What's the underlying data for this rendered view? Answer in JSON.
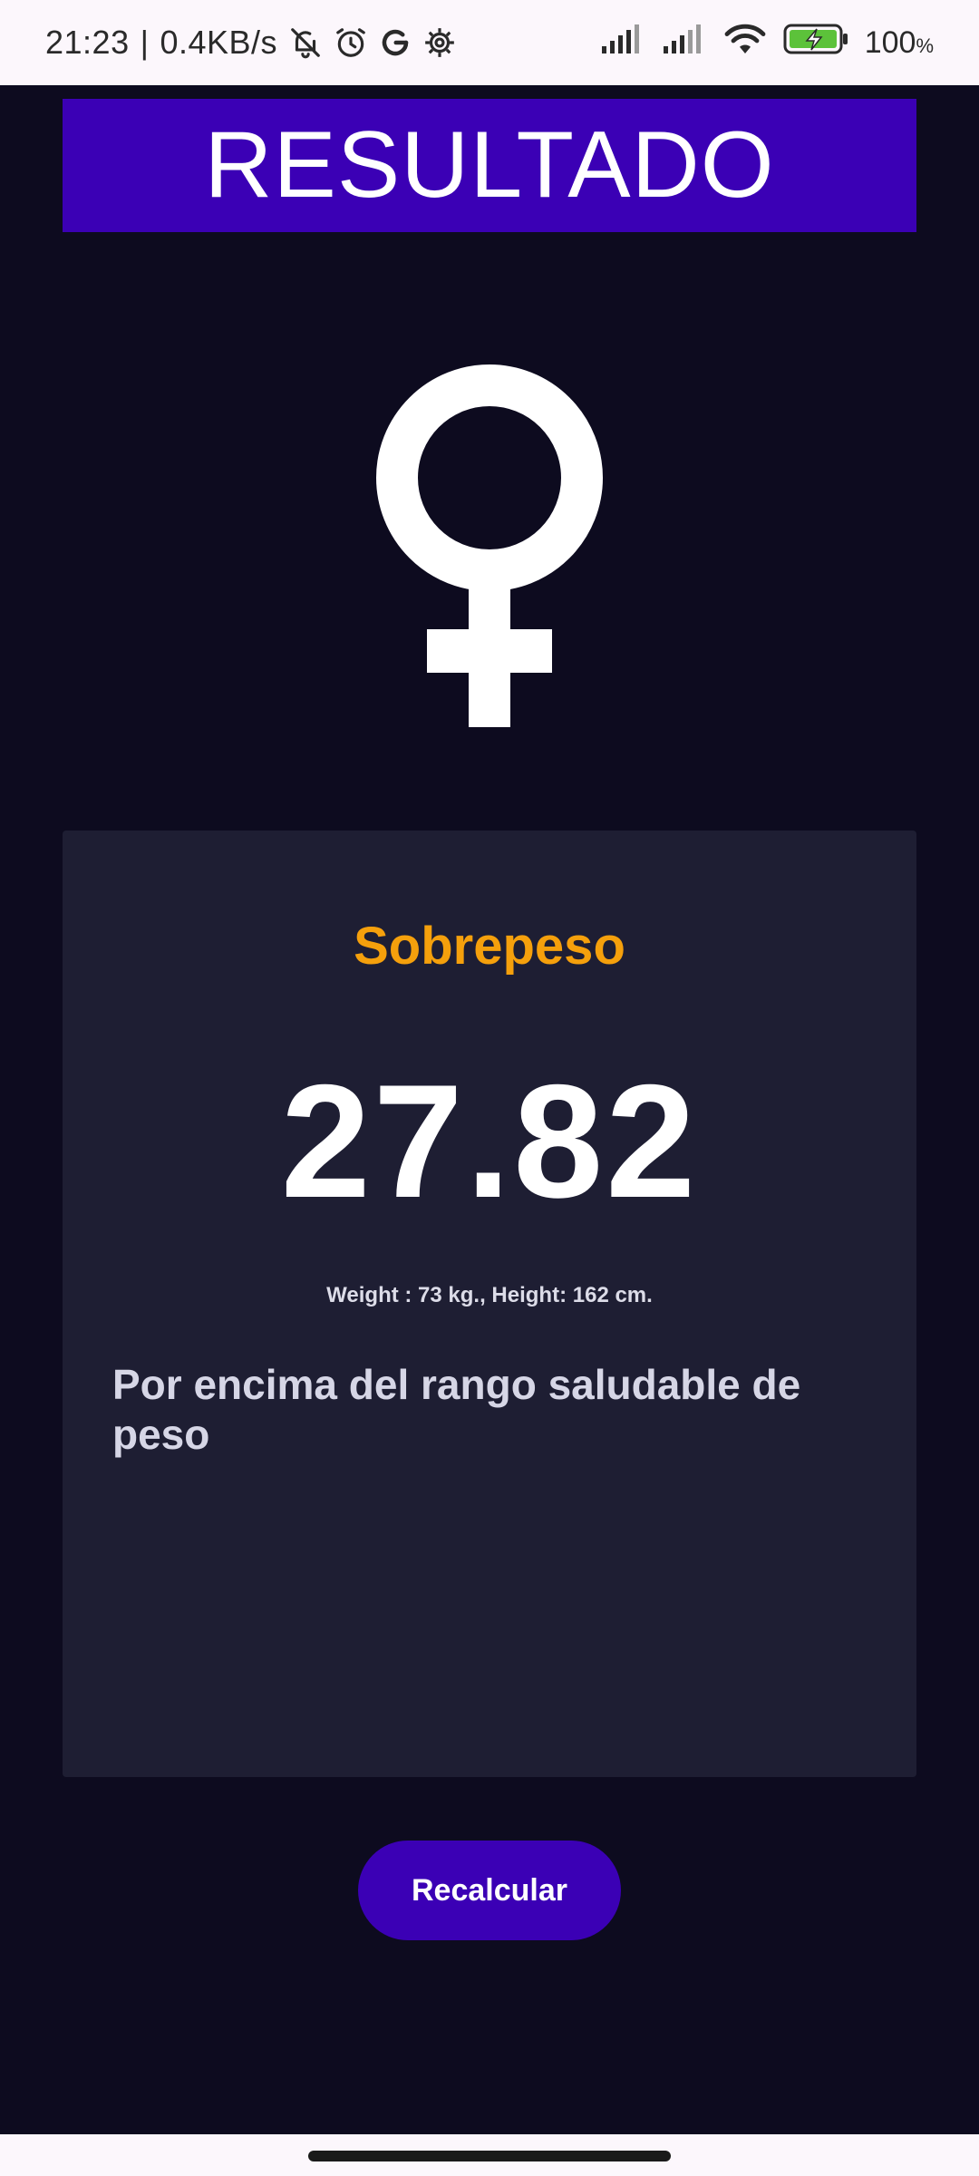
{
  "status_bar": {
    "time": "21:23",
    "separator": "|",
    "network_speed": "0.4KB/s",
    "left_icons": [
      "bell-off-icon",
      "alarm-icon",
      "google-icon",
      "settings-icon"
    ],
    "right_icons": [
      "signal-icon",
      "signal-icon",
      "wifi-icon",
      "battery-charging-icon"
    ],
    "battery_level": "100",
    "battery_unit": "%"
  },
  "header": {
    "title": "RESULTADO"
  },
  "gender": {
    "icon": "female-symbol-icon",
    "color": "#FFFFFF"
  },
  "result": {
    "category": "Sobrepeso",
    "category_color": "#F5A00C",
    "bmi": "27.82",
    "details": "Weight : 73 kg., Height: 162 cm.",
    "description": "Por encima del rango saludable de peso"
  },
  "actions": {
    "recalculate_label": "Recalcular"
  },
  "colors": {
    "background": "#0D0B1F",
    "card": "#1E1E33",
    "accent": "#3B00B5"
  }
}
